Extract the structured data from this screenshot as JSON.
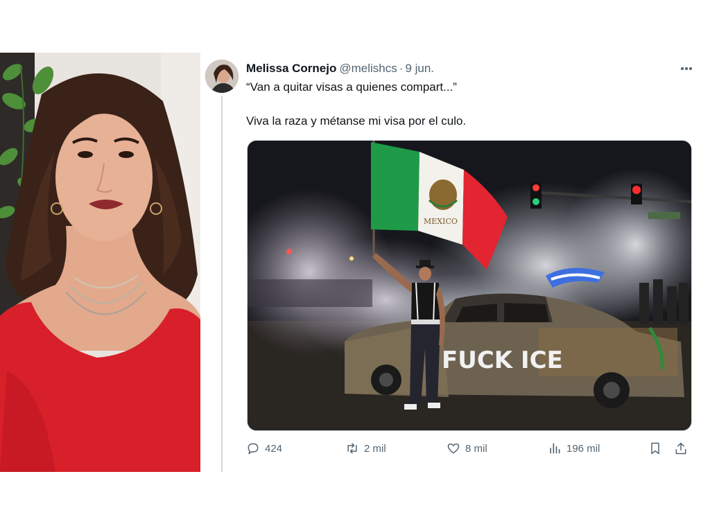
{
  "tweet": {
    "author_name": "Melissa Cornejo",
    "author_handle": "@melishcs",
    "separator": "·",
    "date": "9 jun.",
    "quoted_text": "“Van a quitar visas a quienes compart...”",
    "body_text": "Viva la raza y métanse mi visa por el culo.",
    "media": {
      "flag_text": "MEXICO",
      "graffiti_text": "FUCK ICE"
    },
    "metrics": {
      "replies": "424",
      "retweets": "2 mil",
      "likes": "8 mil",
      "views": "196 mil"
    }
  },
  "icons": {
    "reply": "reply-icon",
    "retweet": "retweet-icon",
    "like": "heart-icon",
    "views": "views-chart-icon",
    "bookmark": "bookmark-icon",
    "share": "share-icon",
    "more": "more-dots-icon"
  },
  "colors": {
    "text_primary": "#0f1419",
    "text_secondary": "#536471",
    "divider": "#cfd9de",
    "dress_red": "#d8202a"
  }
}
